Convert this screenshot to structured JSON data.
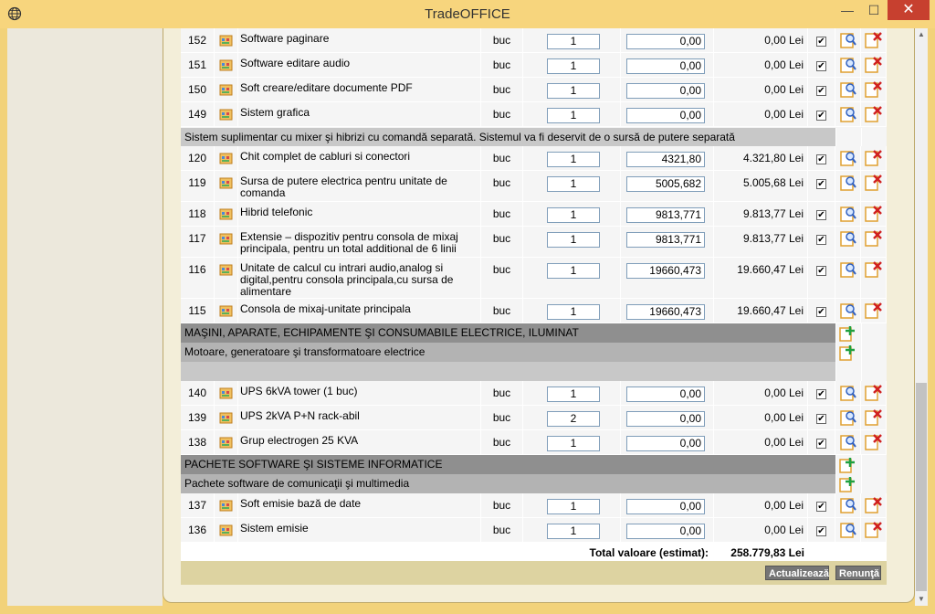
{
  "window": {
    "title": "TradeOFFICE",
    "minimize": "—",
    "maximize": "☐",
    "close": "✕"
  },
  "groups": [
    {
      "id": "g0",
      "rows": [
        {
          "no": "152",
          "name": "Software paginare",
          "um": "buc",
          "qty": "1",
          "price": "0,00",
          "total": "0,00 Lei",
          "checked": true
        },
        {
          "no": "151",
          "name": "Software editare audio",
          "um": "buc",
          "qty": "1",
          "price": "0,00",
          "total": "0,00 Lei",
          "checked": true
        },
        {
          "no": "150",
          "name": "Soft creare/editare documente PDF",
          "um": "buc",
          "qty": "1",
          "price": "0,00",
          "total": "0,00 Lei",
          "checked": true
        },
        {
          "no": "149",
          "name": "Sistem grafica",
          "um": "buc",
          "qty": "1",
          "price": "0,00",
          "total": "0,00 Lei",
          "checked": true
        }
      ]
    }
  ],
  "sections": {
    "sub_mixer": "Sistem suplimentar cu mixer şi hibrizi cu comandă separată. Sistemul va fi deservit de o sursă de putere separată",
    "cat_masini": "MAŞINI, APARATE, ECHIPAMENTE ŞI CONSUMABILE ELECTRICE, ILUMINAT",
    "sub_motoare": "Motoare, generatoare şi transformatoare electrice",
    "cat_software": "PACHETE SOFTWARE ŞI SISTEME INFORMATICE",
    "sub_pachete": "Pachete software de comunicaţii şi multimedia"
  },
  "mixer_rows": [
    {
      "no": "120",
      "name": "Chit complet de cabluri si conectori",
      "um": "buc",
      "qty": "1",
      "price": "4321,80",
      "total": "4.321,80 Lei",
      "checked": true
    },
    {
      "no": "119",
      "name": "Sursa de putere electrica pentru unitate de comanda",
      "um": "buc",
      "qty": "1",
      "price": "5005,682",
      "total": "5.005,68 Lei",
      "checked": true
    },
    {
      "no": "118",
      "name": "Hibrid telefonic",
      "um": "buc",
      "qty": "1",
      "price": "9813,771",
      "total": "9.813,77 Lei",
      "checked": true
    },
    {
      "no": "117",
      "name": "Extensie – dispozitiv pentru consola de mixaj principala, pentru un total additional de 6 linii",
      "um": "buc",
      "qty": "1",
      "price": "9813,771",
      "total": "9.813,77 Lei",
      "checked": true
    },
    {
      "no": "116",
      "name": "Unitate de calcul cu intrari audio,analog si digital,pentru consola principala,cu sursa de alimentare",
      "um": "buc",
      "qty": "1",
      "price": "19660,473",
      "total": "19.660,47 Lei",
      "checked": true
    },
    {
      "no": "115",
      "name": "Consola de mixaj-unitate principala",
      "um": "buc",
      "qty": "1",
      "price": "19660,473",
      "total": "19.660,47 Lei",
      "checked": true
    }
  ],
  "motor_rows": [
    {
      "no": "140",
      "name": "UPS 6kVA tower (1 buc)",
      "um": "buc",
      "qty": "1",
      "price": "0,00",
      "total": "0,00 Lei",
      "checked": true
    },
    {
      "no": "139",
      "name": "UPS 2kVA P+N rack-abil",
      "um": "buc",
      "qty": "2",
      "price": "0,00",
      "total": "0,00 Lei",
      "checked": true
    },
    {
      "no": "138",
      "name": "Grup electrogen 25 KVA",
      "um": "buc",
      "qty": "1",
      "price": "0,00",
      "total": "0,00 Lei",
      "checked": true
    }
  ],
  "software_rows": [
    {
      "no": "137",
      "name": "Soft emisie bază de date",
      "um": "buc",
      "qty": "1",
      "price": "0,00",
      "total": "0,00 Lei",
      "checked": true
    },
    {
      "no": "136",
      "name": "Sistem emisie",
      "um": "buc",
      "qty": "1",
      "price": "0,00",
      "total": "0,00 Lei",
      "checked": true
    }
  ],
  "total": {
    "label": "Total valoare (estimat):",
    "value": "258.779,83 Lei"
  },
  "footer": {
    "update": "Actualizează",
    "cancel": "Renunţă"
  },
  "icons": {
    "package": "package-icon",
    "edit": "edit-search-icon",
    "delete": "delete-icon",
    "add": "add-icon",
    "app": "globe-icon"
  }
}
